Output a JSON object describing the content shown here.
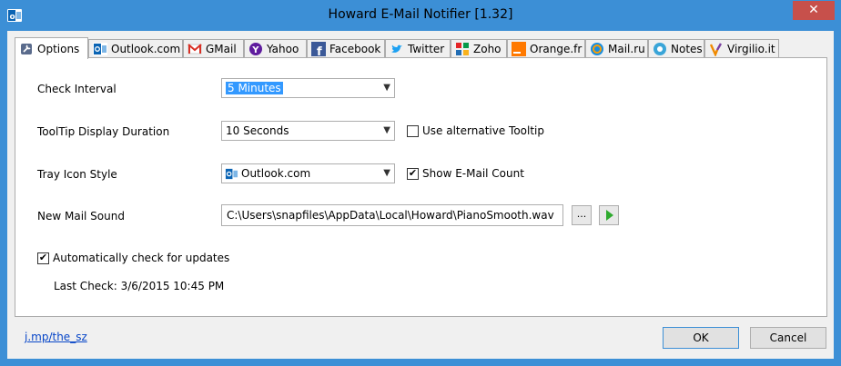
{
  "window": {
    "title": "Howard E-Mail Notifier [1.32]",
    "close_glyph": "✕"
  },
  "tabs": [
    {
      "label": "Options",
      "icon": "wrench-icon"
    },
    {
      "label": "Outlook.com",
      "icon": "outlook-icon"
    },
    {
      "label": "GMail",
      "icon": "gmail-icon"
    },
    {
      "label": "Yahoo",
      "icon": "yahoo-icon"
    },
    {
      "label": "Facebook",
      "icon": "facebook-icon"
    },
    {
      "label": "Twitter",
      "icon": "twitter-icon"
    },
    {
      "label": "Zoho",
      "icon": "zoho-icon"
    },
    {
      "label": "Orange.fr",
      "icon": "orange-icon"
    },
    {
      "label": "Mail.ru",
      "icon": "mailru-icon"
    },
    {
      "label": "Notes",
      "icon": "notes-icon"
    },
    {
      "label": "Virgilio.it",
      "icon": "virgilio-icon"
    }
  ],
  "options": {
    "check_interval_label": "Check Interval",
    "check_interval_value": "5 Minutes",
    "tooltip_duration_label": "ToolTip Display Duration",
    "tooltip_duration_value": "10 Seconds",
    "alt_tooltip_label": "Use alternative Tooltip",
    "alt_tooltip_checked": false,
    "tray_icon_label": "Tray Icon Style",
    "tray_icon_value": "Outlook.com",
    "show_count_label": "Show E-Mail Count",
    "show_count_checked": true,
    "sound_label": "New Mail Sound",
    "sound_value": "C:\\Users\\snapfiles\\AppData\\Local\\Howard\\PianoSmooth.wav",
    "browse_label": "...",
    "play_icon": "play-icon",
    "auto_update_label": "Automatically check for updates",
    "auto_update_checked": true,
    "last_check": "Last Check: 3/6/2015 10:45 PM"
  },
  "footer": {
    "link": "j.mp/the_sz",
    "ok": "OK",
    "cancel": "Cancel"
  },
  "colors": {
    "titlebar": "#3c8fd6",
    "close": "#c7504b",
    "selection": "#3399ff",
    "play": "#2eaa2e"
  }
}
